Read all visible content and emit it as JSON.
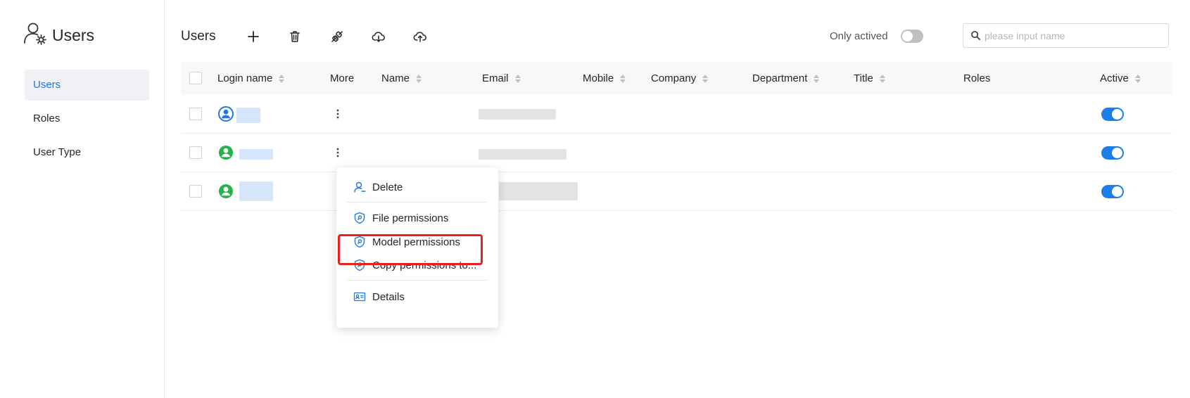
{
  "sidebar": {
    "title": "Users",
    "items": [
      {
        "label": "Users",
        "active": true
      },
      {
        "label": "Roles",
        "active": false
      },
      {
        "label": "User Type",
        "active": false
      }
    ]
  },
  "toolbar": {
    "title": "Users",
    "buttons": [
      "add-icon",
      "trash-icon",
      "link-icon",
      "cloud-download-icon",
      "cloud-upload-icon"
    ],
    "only_actived_label": "Only actived",
    "only_actived": false
  },
  "search": {
    "placeholder": "please input name",
    "value": ""
  },
  "table": {
    "columns": [
      "Login name",
      "More",
      "Name",
      "Email",
      "Mobile",
      "Company",
      "Department",
      "Title",
      "Roles",
      "Active"
    ],
    "rows": [
      {
        "avatar_color": "#1c78e8",
        "active": true
      },
      {
        "avatar_color": "#22b24c",
        "active": true
      },
      {
        "avatar_color": "#22b24c",
        "active": true
      }
    ]
  },
  "context_menu": {
    "items": [
      "Delete",
      "File permissions",
      "Model permissions",
      "Copy permissions to...",
      "Details"
    ],
    "highlighted": "Model permissions"
  },
  "colors": {
    "accent": "#1c78e8",
    "highlight_border": "#e8211c"
  }
}
